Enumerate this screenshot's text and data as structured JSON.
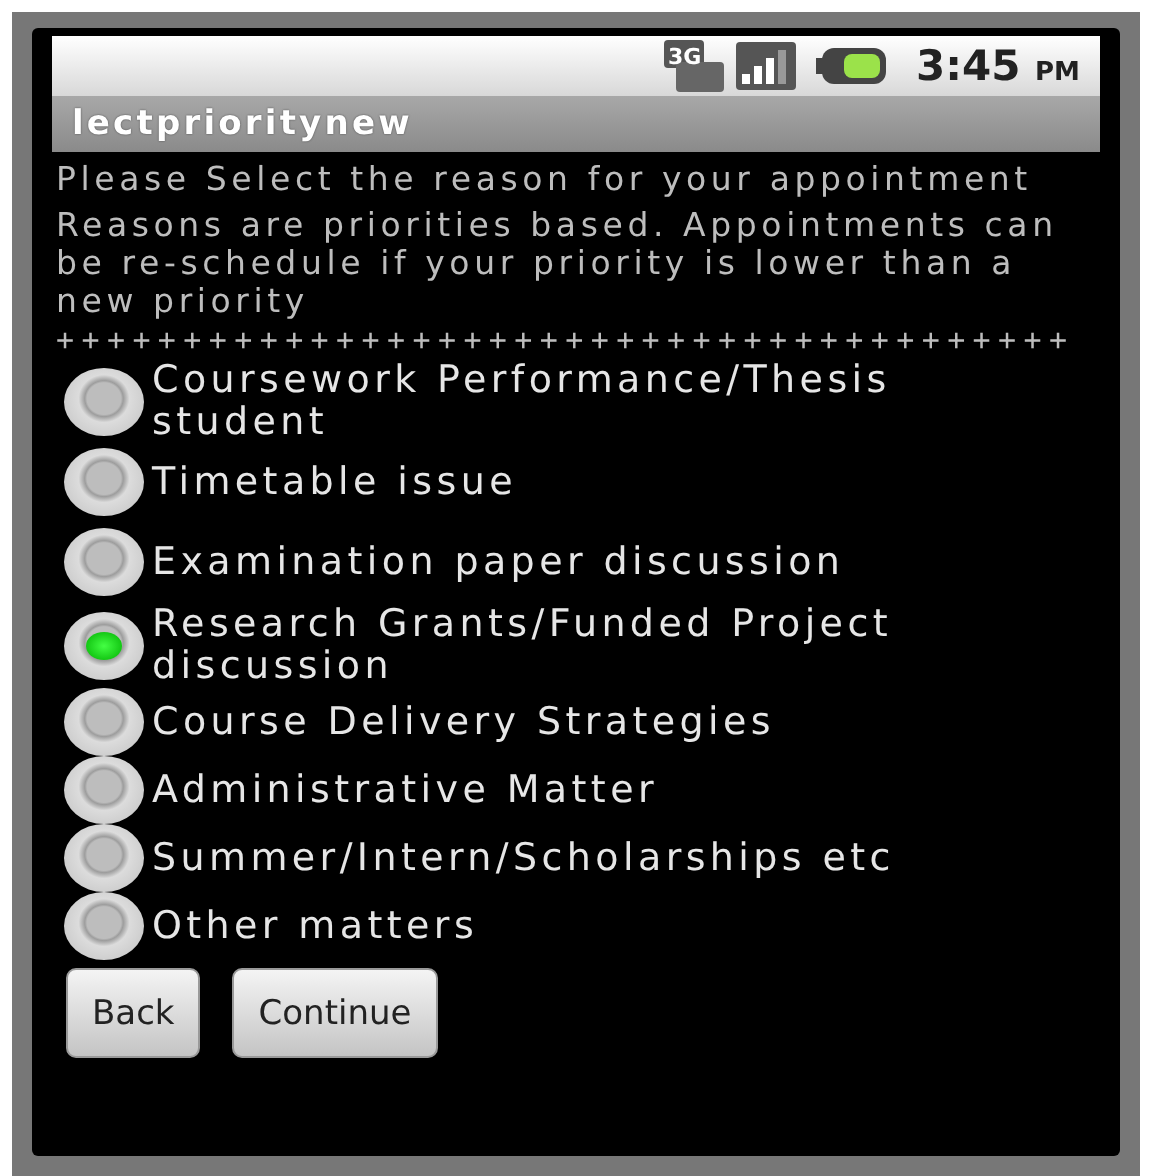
{
  "status_bar": {
    "network": "3G",
    "time": "3:45",
    "meridiem": "PM"
  },
  "window": {
    "title": "lectprioritynew"
  },
  "instructions": [
    "Please Select the reason for your appointment",
    "Reasons are priorities based. Appointments can be re-schedule if your priority is lower than a new priority"
  ],
  "separator": "++++++++++++++++++++++++++++++++++++++++",
  "reasons": [
    {
      "label": "Coursework Performance/Thesis student",
      "selected": false
    },
    {
      "label": "Timetable issue",
      "selected": false
    },
    {
      "label": "Examination paper discussion",
      "selected": false
    },
    {
      "label": "Research Grants/Funded Project discussion",
      "selected": true
    },
    {
      "label": "Course Delivery Strategies",
      "selected": false
    },
    {
      "label": "Administrative Matter",
      "selected": false
    },
    {
      "label": "Summer/Intern/Scholarships etc",
      "selected": false
    },
    {
      "label": "Other matters",
      "selected": false
    }
  ],
  "buttons": [
    "Back",
    "Continue"
  ]
}
